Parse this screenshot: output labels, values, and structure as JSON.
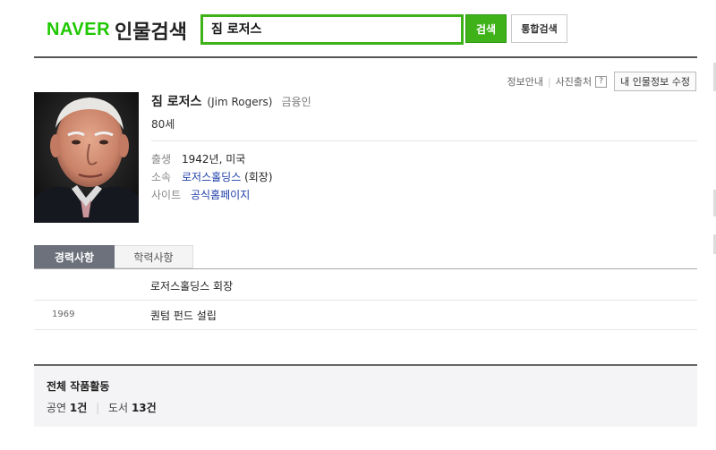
{
  "header": {
    "logo": "NAVER",
    "section_title": "인물검색",
    "search_value": "짐 로저스",
    "search_button": "검색",
    "integrated_button": "통합검색"
  },
  "info_links": {
    "info_guide": "정보안내",
    "photo_source": "사진출처",
    "help": "?",
    "edit": "내 인물정보 수정"
  },
  "profile": {
    "name_ko": "짐 로저스",
    "name_en": "(Jim Rogers)",
    "job": "금융인",
    "age": "80세",
    "birth_label": "출생",
    "birth_value": "1942년, 미국",
    "affiliation_label": "소속",
    "affiliation_link": "로저스홀딩스",
    "affiliation_role": "(회장)",
    "site_label": "사이트",
    "site_link": "공식홈페이지"
  },
  "tabs": [
    "경력사항",
    "학력사항"
  ],
  "career": [
    {
      "year": "",
      "text": "로저스홀딩스 회장"
    },
    {
      "year": "1969",
      "text": "퀀텀 펀드 설립"
    }
  ],
  "works": {
    "title": "전체 작품활동",
    "performance_label": "공연",
    "performance_count": "1건",
    "books_label": "도서",
    "books_count": "13건"
  },
  "colors": {
    "brand_green": "#3fb21a",
    "tab_active": "#6d717c",
    "link": "#1f3ea8"
  }
}
